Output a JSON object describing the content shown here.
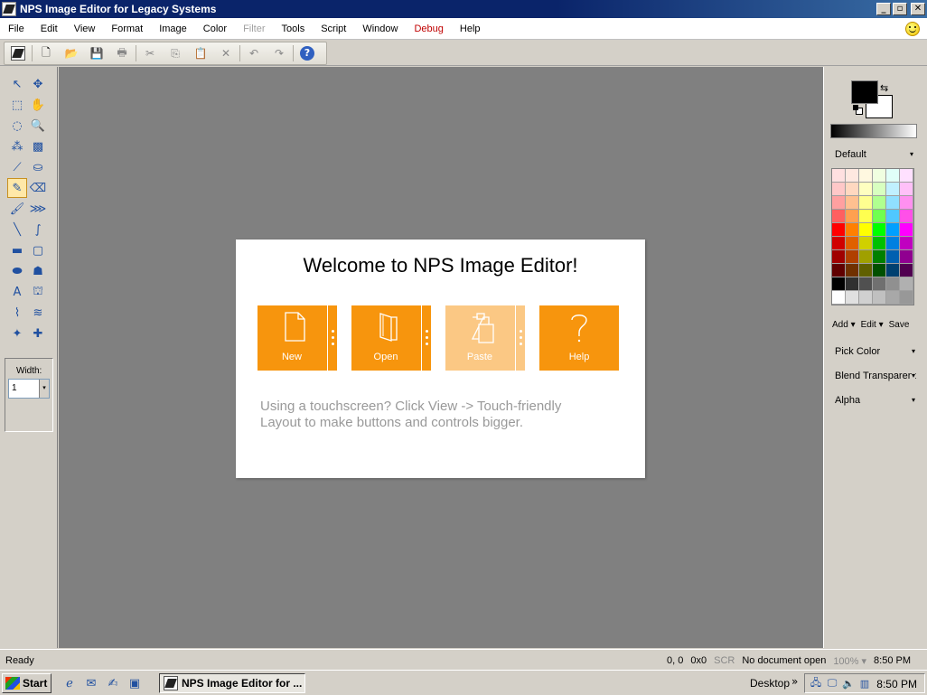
{
  "window": {
    "title": "NPS Image Editor for Legacy Systems",
    "controls": [
      "_",
      "▫",
      "✕"
    ]
  },
  "menu": [
    {
      "label": "File",
      "state": "normal"
    },
    {
      "label": "Edit",
      "state": "normal"
    },
    {
      "label": "View",
      "state": "normal"
    },
    {
      "label": "Format",
      "state": "normal"
    },
    {
      "label": "Image",
      "state": "normal"
    },
    {
      "label": "Color",
      "state": "normal"
    },
    {
      "label": "Filter",
      "state": "disabled"
    },
    {
      "label": "Tools",
      "state": "normal"
    },
    {
      "label": "Script",
      "state": "normal"
    },
    {
      "label": "Window",
      "state": "normal"
    },
    {
      "label": "Debug",
      "state": "debug"
    },
    {
      "label": "Help",
      "state": "normal"
    }
  ],
  "toolbar": {
    "buttons": [
      {
        "name": "new-document-icon",
        "glyph": "🗋",
        "enabled": true
      },
      {
        "name": "open-folder-icon",
        "glyph": "📂",
        "enabled": true
      },
      {
        "name": "save-icon",
        "glyph": "💾",
        "enabled": false
      },
      {
        "name": "print-icon",
        "glyph": "🖶",
        "enabled": false
      },
      {
        "name": "cut-icon",
        "glyph": "✂",
        "enabled": false
      },
      {
        "name": "copy-icon",
        "glyph": "⎘",
        "enabled": false
      },
      {
        "name": "paste-icon",
        "glyph": "📋",
        "enabled": false
      },
      {
        "name": "delete-icon",
        "glyph": "✕",
        "enabled": false
      },
      {
        "name": "undo-icon",
        "glyph": "↶",
        "enabled": false
      },
      {
        "name": "redo-icon",
        "glyph": "↷",
        "enabled": false
      }
    ],
    "help_glyph": "?"
  },
  "tools": [
    {
      "name": "pointer-tool-icon",
      "glyph": "↖"
    },
    {
      "name": "move-tool-icon",
      "glyph": "✥"
    },
    {
      "name": "rect-select-tool-icon",
      "glyph": "⬚"
    },
    {
      "name": "pan-hand-tool-icon",
      "glyph": "✋"
    },
    {
      "name": "lasso-tool-icon",
      "glyph": "◌"
    },
    {
      "name": "zoom-tool-icon",
      "glyph": "🔍"
    },
    {
      "name": "magic-wand-tool-icon",
      "glyph": "⁂"
    },
    {
      "name": "gradient-tool-icon",
      "glyph": "▩"
    },
    {
      "name": "color-picker-tool-icon",
      "glyph": "⟋"
    },
    {
      "name": "paint-bucket-tool-icon",
      "glyph": "⛀"
    },
    {
      "name": "pencil-tool-icon",
      "glyph": "✎",
      "selected": true
    },
    {
      "name": "eraser-tool-icon",
      "glyph": "⌫"
    },
    {
      "name": "brush-tool-icon",
      "glyph": "🖌"
    },
    {
      "name": "clone-stamp-tool-icon",
      "glyph": "⋙"
    },
    {
      "name": "line-tool-icon",
      "glyph": "╲"
    },
    {
      "name": "curve-tool-icon",
      "glyph": "∫"
    },
    {
      "name": "rectangle-tool-icon",
      "glyph": "▬"
    },
    {
      "name": "rounded-rect-tool-icon",
      "glyph": "▢"
    },
    {
      "name": "ellipse-tool-icon",
      "glyph": "⬬"
    },
    {
      "name": "freeform-shape-tool-icon",
      "glyph": "☗"
    },
    {
      "name": "text-tool-icon",
      "glyph": "A"
    },
    {
      "name": "stamp-tool-icon",
      "glyph": "⛫"
    },
    {
      "name": "smudge-tool-icon",
      "glyph": "⌇"
    },
    {
      "name": "recolor-tool-icon",
      "glyph": "≋"
    },
    {
      "name": "sparkle-tool-icon",
      "glyph": "✦"
    },
    {
      "name": "plus-tool-icon",
      "glyph": "✚"
    }
  ],
  "width_panel": {
    "label": "Width:",
    "value": "1",
    "caret": "▾"
  },
  "welcome": {
    "title": "Welcome to NPS Image Editor!",
    "tiles": [
      {
        "label": "New",
        "icon": "new-file-icon",
        "faded": false,
        "has_more": true
      },
      {
        "label": "Open",
        "icon": "open-folder-icon",
        "faded": false,
        "has_more": true
      },
      {
        "label": "Paste",
        "icon": "paste-clipboard-icon",
        "faded": true,
        "has_more": true
      },
      {
        "label": "Help",
        "icon": "question-mark-icon",
        "faded": false,
        "has_more": false
      }
    ],
    "hint": "Using a touchscreen? Click View -> Touch-friendly Layout to make buttons and controls bigger."
  },
  "colors": {
    "primary": "#000000",
    "secondary": "#ffffff",
    "accent_orange": "#f7950d",
    "palette": [
      "#ffe0e0",
      "#ffe8e0",
      "#fff8e0",
      "#f0ffe0",
      "#e0fff8",
      "#ffe0ff",
      "#ffc8c8",
      "#ffd8c0",
      "#ffffc0",
      "#d8ffc0",
      "#c0f0ff",
      "#ffc0f8",
      "#ffa0a0",
      "#ffc090",
      "#ffff90",
      "#b0ff90",
      "#90e0ff",
      "#ff90f0",
      "#ff6060",
      "#ffa050",
      "#ffff50",
      "#70ff50",
      "#50c8ff",
      "#ff50e8",
      "#ff0000",
      "#ff8000",
      "#ffff00",
      "#00ff00",
      "#00a0ff",
      "#ff00ff",
      "#d00000",
      "#e06000",
      "#d0d000",
      "#00c000",
      "#0080e0",
      "#c000c0",
      "#a00000",
      "#b04000",
      "#a0a000",
      "#008000",
      "#0060b0",
      "#900090",
      "#600000",
      "#703000",
      "#606000",
      "#005000",
      "#004070",
      "#500050",
      "#000000",
      "#303030",
      "#505050",
      "#707070",
      "#909090",
      "#b0b0b0",
      "#ffffff",
      "#e0e0e0",
      "#d0d0d0",
      "#c0c0c0",
      "#a8a8a8",
      "#989898"
    ],
    "palette_name": "Default",
    "actions": {
      "add": "Add ▾",
      "edit": "Edit ▾",
      "save": "Save"
    },
    "dropdowns": [
      "Pick Color",
      "Blend Transparent",
      "Alpha"
    ],
    "caret": "▾",
    "swap_glyph": "⇆"
  },
  "status": {
    "left": "Ready",
    "position": "0, 0",
    "size": "0x0",
    "scr": "SCR",
    "document": "No document open",
    "zoom": "100% ▾",
    "time": "8:50 PM"
  },
  "taskbar": {
    "start": "Start",
    "quick_launch": [
      {
        "name": "internet-explorer-icon",
        "glyph": "ℯ"
      },
      {
        "name": "outlook-icon",
        "glyph": "✉"
      },
      {
        "name": "notes-icon",
        "glyph": "✍"
      },
      {
        "name": "desktop-show-icon",
        "glyph": "▣"
      }
    ],
    "task_button": "NPS Image Editor for ...",
    "desktop": "Desktop",
    "chevron": "»",
    "tray_icons": [
      {
        "name": "network-icon",
        "glyph": "🖧"
      },
      {
        "name": "display-icon",
        "glyph": "🖵"
      },
      {
        "name": "volume-icon",
        "glyph": "🔈"
      },
      {
        "name": "taskmgr-icon",
        "glyph": "▥"
      }
    ],
    "time": "8:50 PM"
  }
}
